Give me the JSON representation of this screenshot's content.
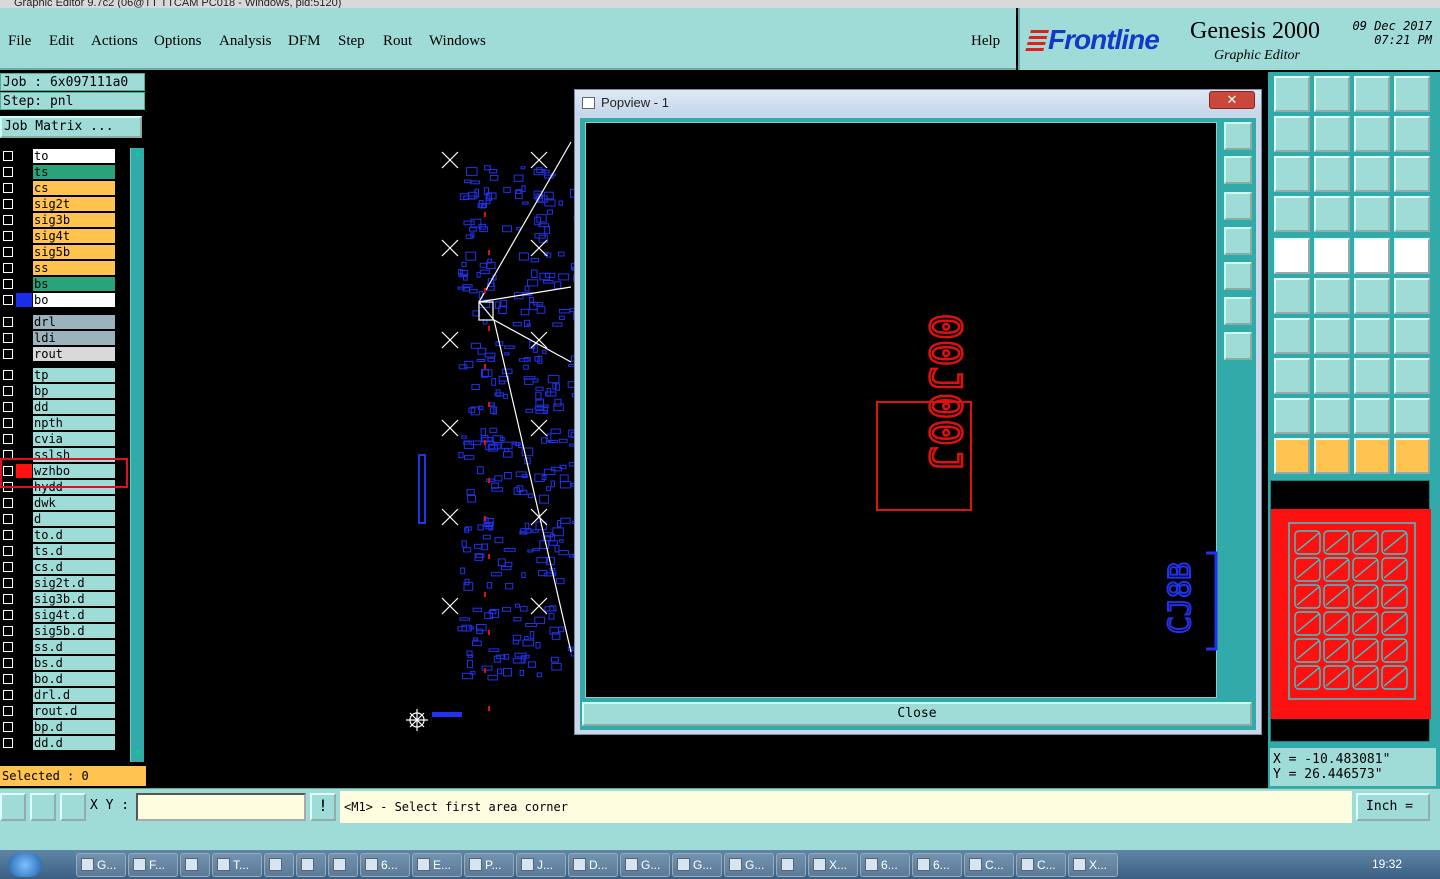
{
  "window": {
    "title": "Graphic Editor 9.7c2 (06@TT TTCAM PC018 - Windows, pid:5120)"
  },
  "menu": [
    "File",
    "Edit",
    "Actions",
    "Options",
    "Analysis",
    "DFM",
    "Step",
    "Rout",
    "Windows"
  ],
  "help_label": "Help",
  "brand": {
    "logo": "Frontline",
    "app": "Genesis 2000",
    "sub": "Graphic Editor",
    "date": "09 Dec 2017",
    "time": "07:21 PM"
  },
  "left": {
    "job": "Job : 6x097111a0",
    "step": "Step: pnl",
    "job_matrix": "Job Matrix ...",
    "selected": "Selected : 0",
    "layers": [
      {
        "name": "to",
        "color": "#ffffff",
        "swatch": ""
      },
      {
        "name": "ts",
        "color": "#2aa37a",
        "swatch": ""
      },
      {
        "name": "cs",
        "color": "#ffc350",
        "swatch": ""
      },
      {
        "name": "sig2t",
        "color": "#ffc350",
        "swatch": ""
      },
      {
        "name": "sig3b",
        "color": "#ffc350",
        "swatch": ""
      },
      {
        "name": "sig4t",
        "color": "#ffc350",
        "swatch": ""
      },
      {
        "name": "sig5b",
        "color": "#ffc350",
        "swatch": ""
      },
      {
        "name": "ss",
        "color": "#ffc350",
        "swatch": ""
      },
      {
        "name": "bs",
        "color": "#2aa37a",
        "swatch": ""
      },
      {
        "name": "bo",
        "color": "#ffffff",
        "swatch": "#1a2ee8"
      },
      {
        "name": "drl",
        "color": "#9ab3bd",
        "swatch": ""
      },
      {
        "name": "ldi",
        "color": "#9ab3bd",
        "swatch": ""
      },
      {
        "name": "rout",
        "color": "#d9d9d9",
        "swatch": ""
      },
      {
        "name": "tp",
        "color": "#9fdcd8",
        "swatch": ""
      },
      {
        "name": "bp",
        "color": "#9fdcd8",
        "swatch": ""
      },
      {
        "name": "dd",
        "color": "#9fdcd8",
        "swatch": ""
      },
      {
        "name": "npth",
        "color": "#9fdcd8",
        "swatch": ""
      },
      {
        "name": "cvia",
        "color": "#9fdcd8",
        "swatch": ""
      },
      {
        "name": "sslsh",
        "color": "#9fdcd8",
        "swatch": ""
      },
      {
        "name": "wzhbo",
        "color": "#9fdcd8",
        "swatch": "#ff1010"
      },
      {
        "name": "hydd",
        "color": "#9fdcd8",
        "swatch": ""
      },
      {
        "name": "dwk",
        "color": "#9fdcd8",
        "swatch": ""
      },
      {
        "name": "d",
        "color": "#9fdcd8",
        "swatch": ""
      },
      {
        "name": "to.d",
        "color": "#9fdcd8",
        "swatch": ""
      },
      {
        "name": "ts.d",
        "color": "#9fdcd8",
        "swatch": ""
      },
      {
        "name": "cs.d",
        "color": "#9fdcd8",
        "swatch": ""
      },
      {
        "name": "sig2t.d",
        "color": "#9fdcd8",
        "swatch": ""
      },
      {
        "name": "sig3b.d",
        "color": "#9fdcd8",
        "swatch": ""
      },
      {
        "name": "sig4t.d",
        "color": "#9fdcd8",
        "swatch": ""
      },
      {
        "name": "sig5b.d",
        "color": "#9fdcd8",
        "swatch": ""
      },
      {
        "name": "ss.d",
        "color": "#9fdcd8",
        "swatch": ""
      },
      {
        "name": "bs.d",
        "color": "#9fdcd8",
        "swatch": ""
      },
      {
        "name": "bo.d",
        "color": "#9fdcd8",
        "swatch": ""
      },
      {
        "name": "drl.d",
        "color": "#9fdcd8",
        "swatch": ""
      },
      {
        "name": "rout.d",
        "color": "#9fdcd8",
        "swatch": ""
      },
      {
        "name": "bp.d",
        "color": "#9fdcd8",
        "swatch": ""
      },
      {
        "name": "dd.d",
        "color": "#9fdcd8",
        "swatch": ""
      }
    ]
  },
  "popview": {
    "title": "Popview - 1",
    "close_x": "✕",
    "close_label": "Close",
    "text_red": "00J00J",
    "text_blue": "CJ8B"
  },
  "coords": {
    "x": "X = -10.483081\"",
    "y": "Y = 26.446573\""
  },
  "bottom": {
    "xy_label": "X Y :",
    "xy_value": "",
    "status": "<M1> - Select first area corner",
    "unit": "Inch ="
  },
  "taskbar": {
    "items": [
      "G...",
      "F...",
      "",
      "T...",
      "",
      "",
      "",
      "6...",
      "E...",
      "P...",
      "J...",
      "D...",
      "G...",
      "G...",
      "G...",
      "",
      "X...",
      "6...",
      "6...",
      "C...",
      "C...",
      "X..."
    ],
    "time": "19:32"
  },
  "colors": {
    "panel": "#9fdcd8",
    "teal": "#33aaaa",
    "accent_yellow": "#ffc350",
    "pcb_red": "#ff1010",
    "pcb_blue": "#1a2ee8"
  }
}
